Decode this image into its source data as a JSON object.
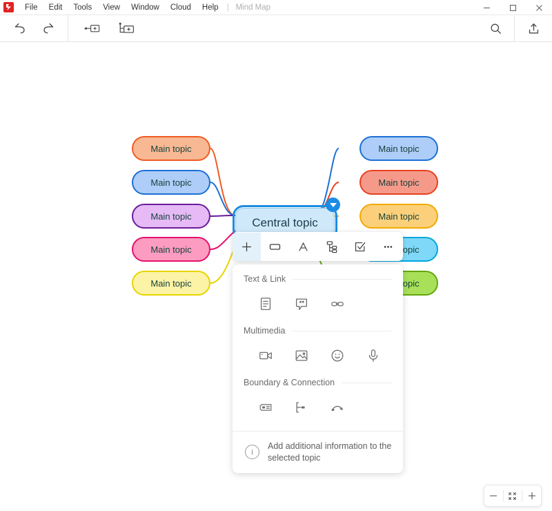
{
  "window": {
    "document_name": "Mind Map",
    "menu_separator": "|",
    "menus": [
      {
        "label": "File"
      },
      {
        "label": "Edit"
      },
      {
        "label": "Tools"
      },
      {
        "label": "View"
      },
      {
        "label": "Window"
      },
      {
        "label": "Cloud"
      },
      {
        "label": "Help"
      }
    ],
    "controls": [
      {
        "name": "minimize-button",
        "icon": "minimize-icon"
      },
      {
        "name": "maximize-button",
        "icon": "maximize-icon"
      },
      {
        "name": "close-button",
        "icon": "close-icon"
      }
    ]
  },
  "toolbar": {
    "undo_icon": "undo-icon",
    "redo_icon": "redo-icon",
    "insert_topic_icon": "insert-topic-icon",
    "insert_subtopic_icon": "insert-subtopic-icon",
    "search_icon": "search-icon",
    "share_icon": "share-icon"
  },
  "map": {
    "central": {
      "label": "Central topic",
      "fill": "#cfe9fa",
      "border": "#8dc6e8",
      "selection_color": "#1b8ce3"
    },
    "left_topics": [
      {
        "label": "Main topic",
        "fill": "#f8b894",
        "border": "#f05a22"
      },
      {
        "label": "Main topic",
        "fill": "#aecdf8",
        "border": "#1b6fd6"
      },
      {
        "label": "Main topic",
        "fill": "#e5baf5",
        "border": "#6b1a9c"
      },
      {
        "label": "Main topic",
        "fill": "#fc9cc0",
        "border": "#e60f6d"
      },
      {
        "label": "Main topic",
        "fill": "#fdf3a6",
        "border": "#e8d400"
      }
    ],
    "right_topics": [
      {
        "label": "Main topic",
        "fill": "#aecdf8",
        "border": "#1b6fd6"
      },
      {
        "label": "Main topic",
        "fill": "#f59a8a",
        "border": "#e8401f"
      },
      {
        "label": "Main topic",
        "fill": "#fcd07a",
        "border": "#f2a900"
      },
      {
        "label": "Main topic",
        "fill": "#7fd8f7",
        "border": "#00a6e0"
      },
      {
        "label": "Main topic",
        "fill": "#a8e05a",
        "border": "#63a70a"
      }
    ]
  },
  "topic_toolbar": {
    "buttons": [
      {
        "name": "add-topic-button",
        "icon": "plus-icon",
        "active": true
      },
      {
        "name": "shape-button",
        "icon": "rectangle-icon",
        "active": false
      },
      {
        "name": "font-button",
        "icon": "font-a-icon",
        "active": false
      },
      {
        "name": "structure-button",
        "icon": "structure-icon",
        "active": false
      },
      {
        "name": "task-button",
        "icon": "checkbox-icon",
        "active": false
      },
      {
        "name": "more-button",
        "icon": "ellipsis-icon",
        "active": false
      }
    ]
  },
  "insert_panel": {
    "sections": [
      {
        "title": "Text & Link",
        "items": [
          {
            "name": "note-item",
            "icon": "note-icon"
          },
          {
            "name": "comment-item",
            "icon": "comment-icon"
          },
          {
            "name": "hyperlink-item",
            "icon": "link-icon"
          }
        ]
      },
      {
        "title": "Multimedia",
        "items": [
          {
            "name": "video-item",
            "icon": "video-icon"
          },
          {
            "name": "image-item",
            "icon": "image-icon"
          },
          {
            "name": "sticker-item",
            "icon": "smiley-icon"
          },
          {
            "name": "audio-item",
            "icon": "microphone-icon"
          }
        ]
      },
      {
        "title": "Boundary & Connection",
        "items": [
          {
            "name": "boundary-item",
            "icon": "boundary-icon"
          },
          {
            "name": "summary-item",
            "icon": "summary-icon"
          },
          {
            "name": "relationship-item",
            "icon": "relationship-icon"
          }
        ]
      }
    ],
    "footer": {
      "info_glyph": "i",
      "text": "Add additional information to the selected topic"
    }
  },
  "zoom_controls": {
    "zoom_out_icon": "minus-icon",
    "fit_icon": "fit-screen-icon",
    "zoom_in_icon": "plus-icon"
  }
}
